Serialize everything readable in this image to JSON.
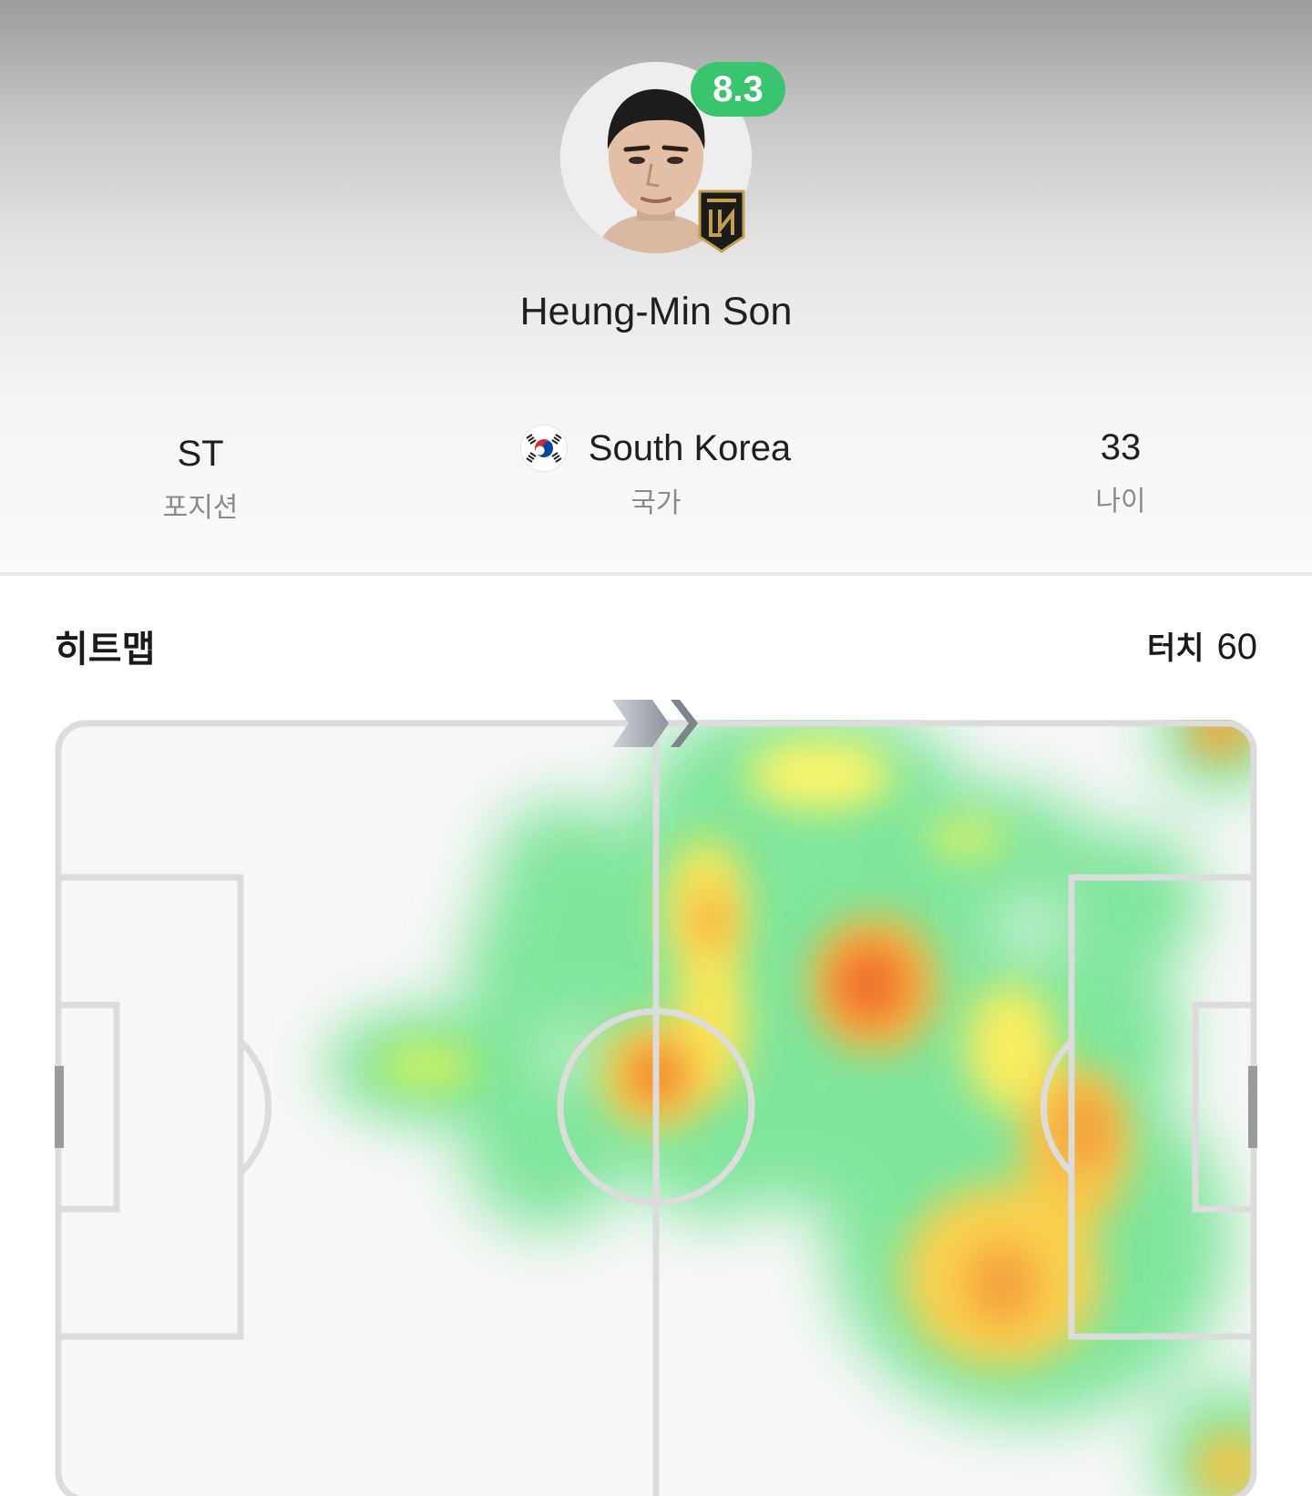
{
  "player": {
    "name": "Heung-Min Son",
    "rating": "8.3",
    "rating_color": "#39c46e",
    "photo_icon": "player-photo",
    "club_crest_icon": "lafc-crest"
  },
  "stats": {
    "position": {
      "value": "ST",
      "label": "포지션"
    },
    "nationality": {
      "value": "South Korea",
      "label": "국가",
      "flag_icon": "south-korea-flag"
    },
    "age": {
      "value": "33",
      "label": "나이"
    }
  },
  "heatmap": {
    "title": "히트맵",
    "touches_label": "터치",
    "touches_value": "60",
    "attack_direction_icon": "chevron-right-icon"
  }
}
